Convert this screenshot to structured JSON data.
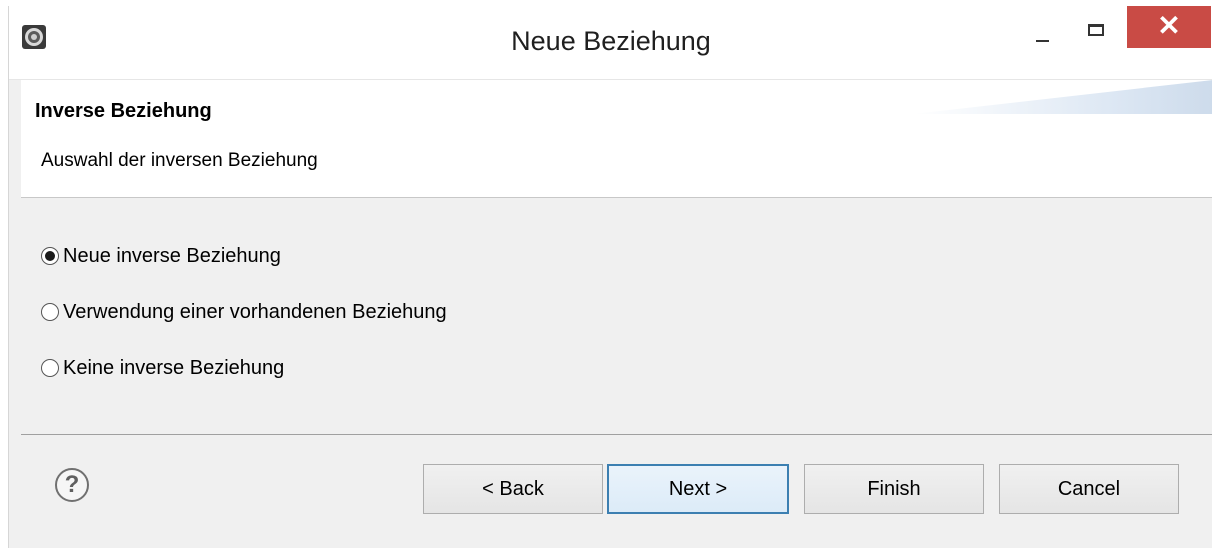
{
  "window": {
    "title": "Neue Beziehung",
    "close_glyph": "✕",
    "app_icon": "eclipse-gear-icon"
  },
  "banner": {
    "title": "Inverse Beziehung",
    "subtitle": "Auswahl der inversen Beziehung"
  },
  "options": [
    {
      "label": "Neue inverse Beziehung",
      "selected": true
    },
    {
      "label": "Verwendung einer vorhandenen Beziehung",
      "selected": false
    },
    {
      "label": "Keine inverse Beziehung",
      "selected": false
    }
  ],
  "footer": {
    "help_glyph": "?",
    "back_label": "< Back",
    "next_label": "Next >",
    "finish_label": "Finish",
    "cancel_label": "Cancel"
  },
  "colors": {
    "close_button": "#c94b45",
    "default_button_border": "#3c7fb1"
  }
}
